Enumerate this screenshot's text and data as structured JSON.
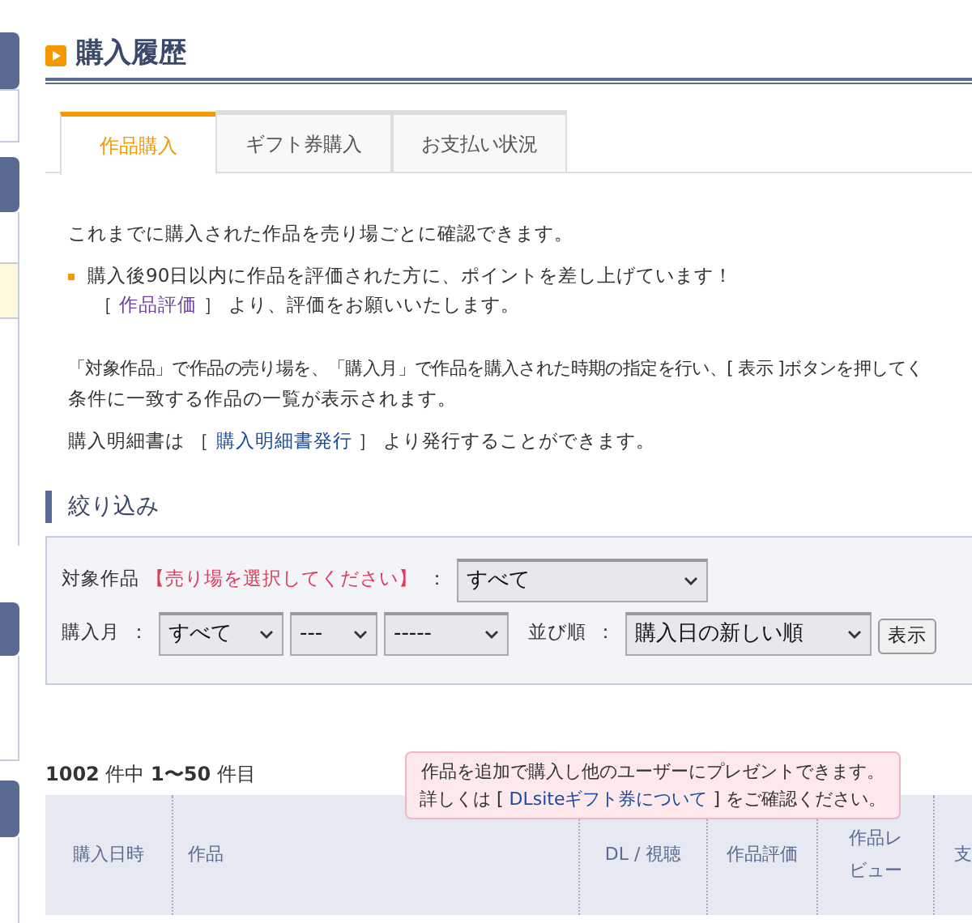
{
  "page_title": "購入履歴",
  "tabs": [
    {
      "label": "作品購入",
      "selected": true
    },
    {
      "label": "ギフト券購入",
      "selected": false
    },
    {
      "label": "お支払い状況",
      "selected": false
    }
  ],
  "intro": "これまでに購入された作品を売り場ごとに確認できます。",
  "notice": {
    "line1": "購入後90日以内に作品を評価された方に、ポイントを差し上げています！",
    "before": "［ ",
    "link": "作品評価",
    "after": " ］ より、評価をお願いいたします。"
  },
  "instructions": [
    "「対象作品」で作品の売り場を、「購入月」で作品を購入された時期の指定を行い、[ 表示 ]ボタンを押してく",
    "条件に一致する作品の一覧が表示されます。"
  ],
  "invoice": {
    "before": "購入明細書は ［ ",
    "link": "購入明細書発行",
    "after": " ］ より発行することができます。"
  },
  "filter": {
    "heading": "絞り込み",
    "target": {
      "label": "対象作品",
      "hint": "【売り場を選択してください】",
      "separator": "：",
      "value": "すべて"
    },
    "month": {
      "label": "購入月",
      "separator": "：",
      "values": [
        "すべて",
        "---",
        "-----"
      ]
    },
    "sort": {
      "label": "並び順",
      "separator": "：",
      "value": "購入日の新しい順"
    },
    "button": "表示"
  },
  "count": "**1002** 件中 **1〜50** 件目",
  "tooltip": {
    "line1": "作品を追加で購入し他のユーザーにプレゼントできます。",
    "before": "詳しくは [ ",
    "link": "DLsiteギフト券について",
    "after": " ] をご確認ください。"
  },
  "table": {
    "columns": [
      "購入日時",
      "作品",
      "DL / 視聴",
      "作品評価",
      "作品レビュー",
      "支"
    ]
  }
}
